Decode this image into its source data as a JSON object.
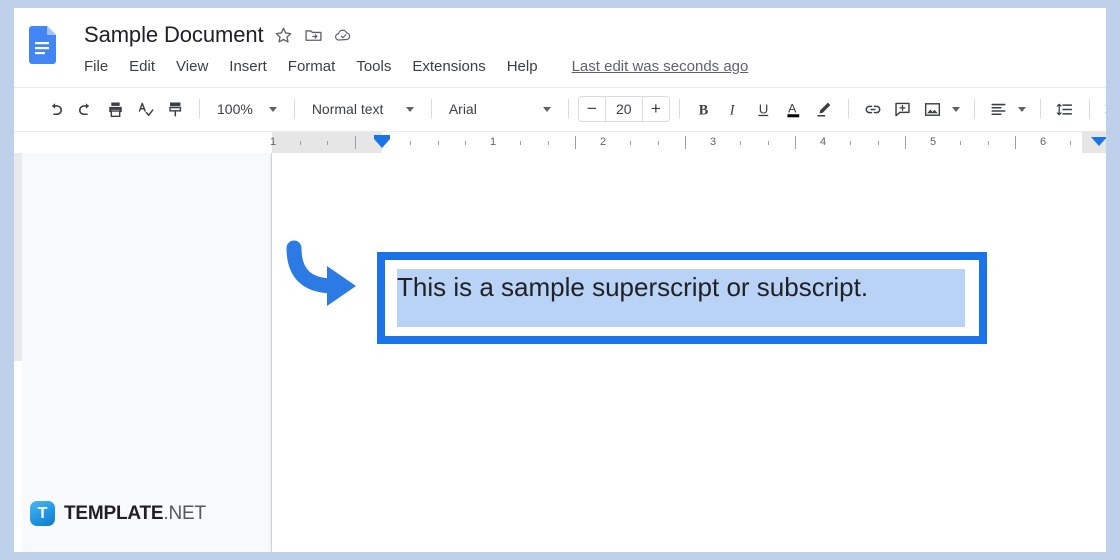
{
  "app": {
    "name": "Google Docs",
    "logo_icon": "google-docs-icon",
    "accent_color": "#1a73e8"
  },
  "header": {
    "doc_title": "Sample Document",
    "title_icons": [
      {
        "name": "star-icon",
        "glyph": "☆"
      },
      {
        "name": "move-to-folder-icon",
        "glyph": "folder"
      },
      {
        "name": "cloud-saved-icon",
        "glyph": "cloud"
      }
    ],
    "menu_items": [
      "File",
      "Edit",
      "View",
      "Insert",
      "Format",
      "Tools",
      "Extensions",
      "Help"
    ],
    "last_edit": "Last edit was seconds ago"
  },
  "toolbar": {
    "undo": "undo-icon",
    "redo": "redo-icon",
    "print": "print-icon",
    "spellcheck": "spellcheck-icon",
    "paint_format": "paint-format-icon",
    "zoom_level": "100%",
    "paragraph_style": "Normal text",
    "font_family": "Arial",
    "font_size": "20",
    "font_size_decrease": "−",
    "font_size_increase": "+",
    "bold": "B",
    "italic": "I",
    "underline": "U",
    "text_color": "A",
    "highlight": "highlight-pen-icon",
    "link": "link-icon",
    "comment": "add-comment-icon",
    "image": "insert-image-icon",
    "align": "align-left-icon",
    "line_spacing": "line-spacing-icon",
    "checklist": "checklist-icon",
    "bulleted_list": "bulleted-list-icon"
  },
  "ruler": {
    "numbers": [
      "1",
      "1",
      "2",
      "3",
      "4",
      "5",
      "6"
    ],
    "left_indent_marker": "left-indent-marker",
    "right-indent_marker": "right-indent-marker"
  },
  "document": {
    "selected_text": "This is a sample superscript or subscript.",
    "highlight_color": "#b9d3f7",
    "annotation_box_color": "#1a73e8",
    "arrow": "curved-arrow-annotation"
  },
  "brand": {
    "badge_letter": "T",
    "name_bold": "TEMPLATE",
    "name_light": ".NET"
  }
}
